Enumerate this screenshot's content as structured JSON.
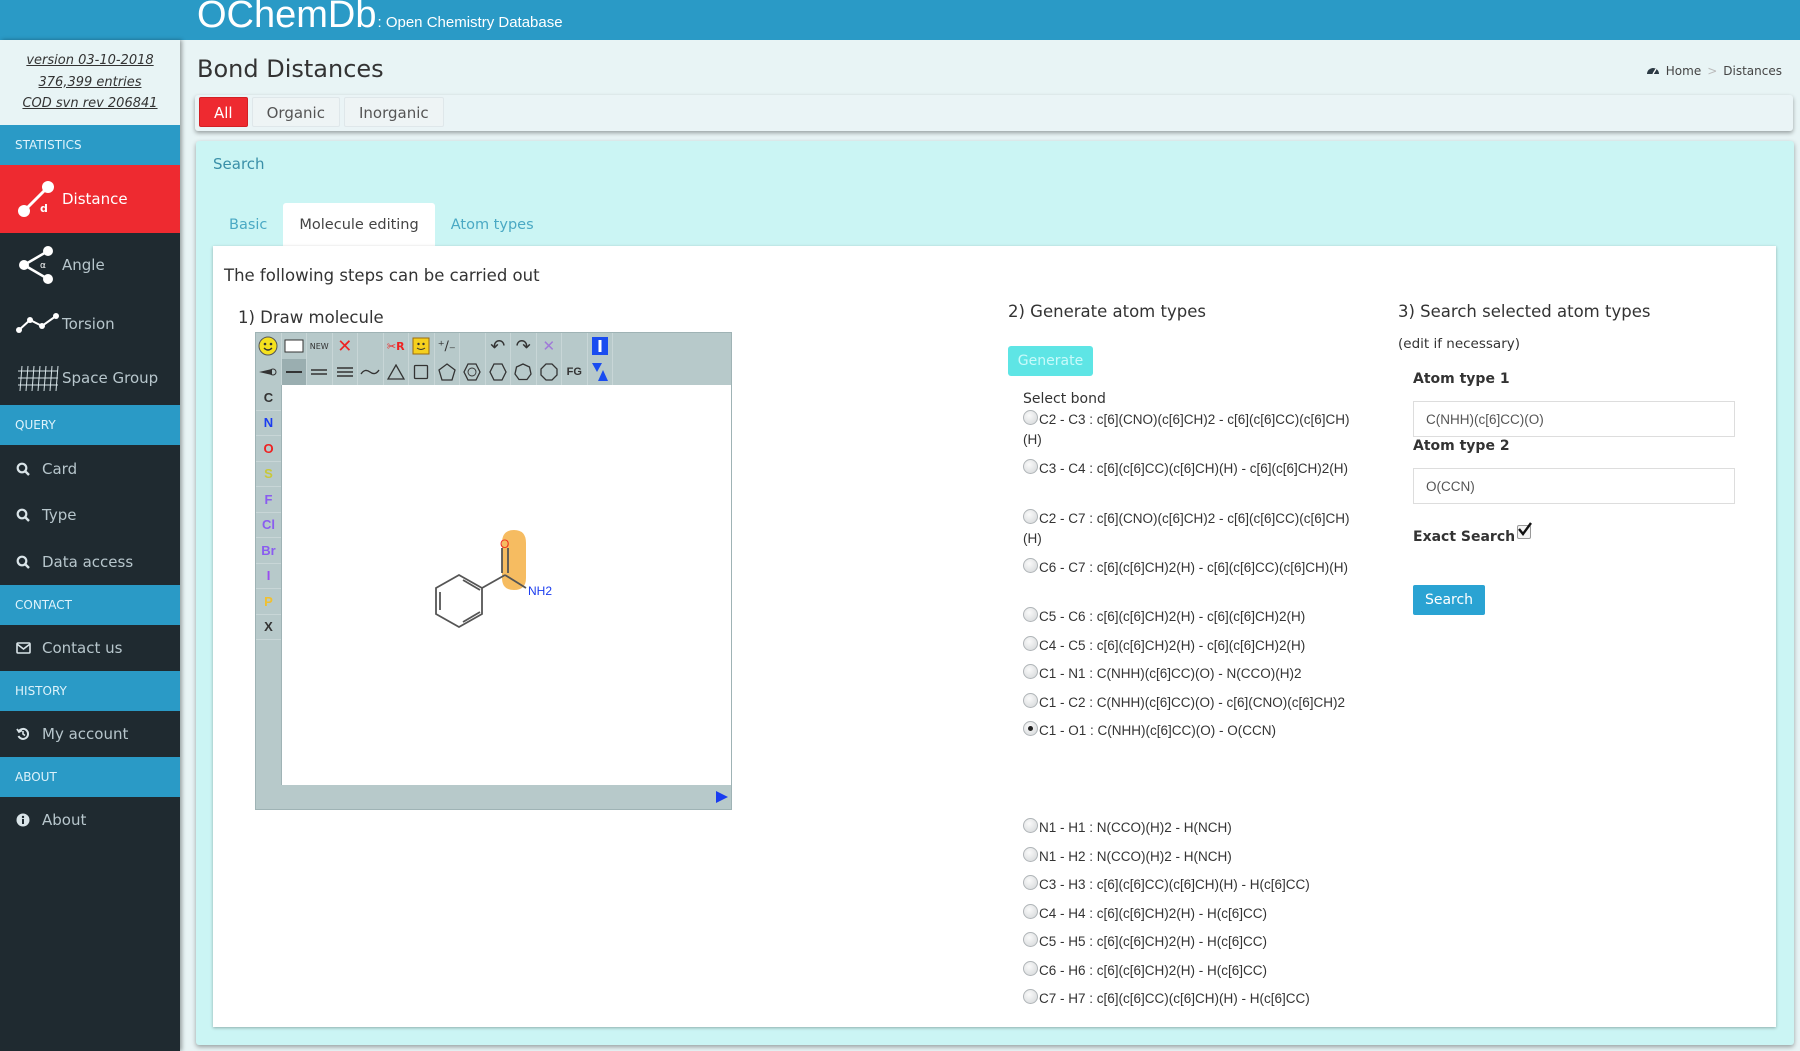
{
  "header": {
    "brand": "OChemDb",
    "tagline": ": Open Chemistry Database"
  },
  "sidebar": {
    "version_lines": [
      "version 03-10-2018",
      "376,399 entries",
      "COD svn rev 206841"
    ],
    "sections": [
      {
        "title": "STATISTICS",
        "items": [
          {
            "label": "Distance",
            "icon": "distance-icon",
            "active": true
          },
          {
            "label": "Angle",
            "icon": "angle-icon"
          },
          {
            "label": "Torsion",
            "icon": "torsion-icon"
          },
          {
            "label": "Space Group",
            "icon": "space-group-icon"
          }
        ]
      },
      {
        "title": "QUERY",
        "items": [
          {
            "label": "Card",
            "icon": "search-icon"
          },
          {
            "label": "Type",
            "icon": "search-icon"
          },
          {
            "label": "Data access",
            "icon": "search-icon"
          }
        ]
      },
      {
        "title": "CONTACT",
        "items": [
          {
            "label": "Contact us",
            "icon": "envelope-icon"
          }
        ]
      },
      {
        "title": "HISTORY",
        "items": [
          {
            "label": "My account",
            "icon": "history-icon"
          }
        ]
      },
      {
        "title": "ABOUT",
        "items": [
          {
            "label": "About",
            "icon": "info-icon"
          }
        ]
      }
    ]
  },
  "page": {
    "title": "Bond Distances",
    "breadcrumb": [
      "Home",
      "Distances"
    ],
    "filters": [
      {
        "label": "All",
        "active": true
      },
      {
        "label": "Organic"
      },
      {
        "label": "Inorganic"
      }
    ]
  },
  "search": {
    "title": "Search",
    "tabs": [
      {
        "label": "Basic"
      },
      {
        "label": "Molecule editing",
        "active": true
      },
      {
        "label": "Atom types"
      }
    ],
    "intro": "The following steps can be carried out",
    "step1": {
      "title": "1) Draw molecule",
      "toolbar_row1": [
        "smiley",
        "rectangle",
        "NEW",
        "delete",
        "blank",
        "R-group",
        "smiley-box",
        "charge",
        "blank",
        "undo",
        "redo",
        "clear",
        "blank",
        "info"
      ],
      "toolbar_row2": [
        "wedge",
        "single-bond",
        "double-bond",
        "triple-bond",
        "chain",
        "triangle",
        "square",
        "pentagon",
        "benzene",
        "hexagon",
        "heptagon",
        "octagon",
        "FG",
        "flip"
      ],
      "elements": [
        {
          "symbol": "C",
          "color": "#333333"
        },
        {
          "symbol": "N",
          "color": "#1a3cf0"
        },
        {
          "symbol": "O",
          "color": "#ee2222"
        },
        {
          "symbol": "S",
          "color": "#c8c83a"
        },
        {
          "symbol": "F",
          "color": "#8a5cf0"
        },
        {
          "symbol": "Cl",
          "color": "#8a5cf0"
        },
        {
          "symbol": "Br",
          "color": "#8a5cf0"
        },
        {
          "symbol": "I",
          "color": "#9a4cf0"
        },
        {
          "symbol": "P",
          "color": "#f0c030"
        },
        {
          "symbol": "X",
          "color": "#333333"
        }
      ],
      "molecule": {
        "name": "benzamide",
        "labels": {
          "oxygen": "O",
          "amine": "NH2"
        }
      }
    },
    "step2": {
      "title": "2) Generate atom types",
      "generate_label": "Generate",
      "select_label": "Select bond",
      "bonds": [
        {
          "text": "C2 - C3 : c[6](CNO)(c[6]CH)2 - c[6](c[6]CC)(c[6]CH)(H)",
          "selected": false
        },
        {
          "text": "C3 - C4 : c[6](c[6]CC)(c[6]CH)(H) - c[6](c[6]CH)2(H)",
          "selected": false
        },
        {
          "text": "C2 - C7 : c[6](CNO)(c[6]CH)2 - c[6](c[6]CC)(c[6]CH)(H)",
          "selected": false
        },
        {
          "text": "C6 - C7 : c[6](c[6]CH)2(H) - c[6](c[6]CC)(c[6]CH)(H)",
          "selected": false
        },
        {
          "text": "C5 - C6 : c[6](c[6]CH)2(H) - c[6](c[6]CH)2(H)",
          "selected": false
        },
        {
          "text": "C4 - C5 : c[6](c[6]CH)2(H) - c[6](c[6]CH)2(H)",
          "selected": false
        },
        {
          "text": "C1 - N1 : C(NHH)(c[6]CC)(O) - N(CCO)(H)2",
          "selected": false
        },
        {
          "text": "C1 - C2 : C(NHH)(c[6]CC)(O) - c[6](CNO)(c[6]CH)2",
          "selected": false
        },
        {
          "text": "C1 - O1 : C(NHH)(c[6]CC)(O) - O(CCN)",
          "selected": true
        },
        {
          "text": "N1 - H1 : N(CCO)(H)2 - H(NCH)",
          "selected": false
        },
        {
          "text": "N1 - H2 : N(CCO)(H)2 - H(NCH)",
          "selected": false
        },
        {
          "text": "C3 - H3 : c[6](c[6]CC)(c[6]CH)(H) - H(c[6]CC)",
          "selected": false
        },
        {
          "text": "C4 - H4 : c[6](c[6]CH)2(H) - H(c[6]CC)",
          "selected": false
        },
        {
          "text": "C5 - H5 : c[6](c[6]CH)2(H) - H(c[6]CC)",
          "selected": false
        },
        {
          "text": "C6 - H6 : c[6](c[6]CH)2(H) - H(c[6]CC)",
          "selected": false
        },
        {
          "text": "C7 - H7 : c[6](c[6]CC)(c[6]CH)(H) - H(c[6]CC)",
          "selected": false
        }
      ]
    },
    "step3": {
      "title": "3) Search selected atom types",
      "subtitle": "(edit if necessary)",
      "atom_type1_label": "Atom type 1",
      "atom_type1_value": "C(NHH)(c[6]CC)(O)",
      "atom_type2_label": "Atom type 2",
      "atom_type2_value": "O(CCN)",
      "exact_label": "Exact Search",
      "exact_checked": true,
      "search_label": "Search"
    }
  },
  "colors": {
    "header": "#2a9ac6",
    "active": "#ee2a30",
    "sidebar_bg": "#1f2a30",
    "panel_bg": "#cbf5f4",
    "search_btn": "#2aa3d3",
    "generate_btn": "#5ee5e5"
  }
}
